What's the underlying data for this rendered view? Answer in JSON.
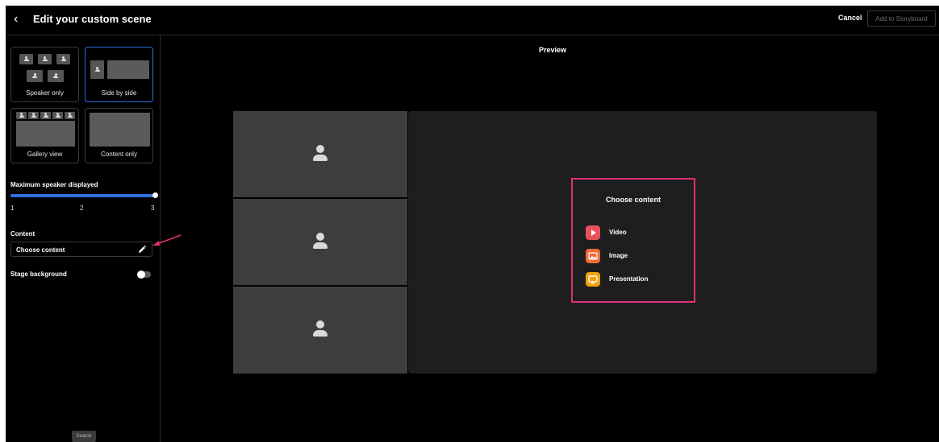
{
  "header": {
    "back_glyph": "‹",
    "title": "Edit your custom scene",
    "cancel_label": "Cancel",
    "add_to_storyboard_label": "Add to Storyboard"
  },
  "sidebar": {
    "layouts": [
      {
        "label": "Speaker only",
        "selected": false,
        "icon": "speaker-only-layout-icon"
      },
      {
        "label": "Side by side",
        "selected": true,
        "icon": "side-by-side-layout-icon"
      },
      {
        "label": "Gallery view",
        "selected": false,
        "icon": "gallery-view-layout-icon"
      },
      {
        "label": "Content only",
        "selected": false,
        "icon": "content-only-layout-icon"
      }
    ],
    "max_speakers": {
      "label": "Maximum speaker displayed",
      "ticks": [
        "1",
        "2",
        "3"
      ],
      "value": 3,
      "min": 1,
      "max": 3
    },
    "content": {
      "label": "Content",
      "field_value": "Choose content",
      "edit_icon": "pencil-icon"
    },
    "stage_background": {
      "label": "Stage background",
      "enabled": false
    },
    "search_label": "Search"
  },
  "preview": {
    "label": "Preview",
    "speaker_tiles": 3,
    "choose_content": {
      "title": "Choose content",
      "options": [
        {
          "label": "Video",
          "icon": "video-play-icon",
          "color": "#e8505b"
        },
        {
          "label": "Image",
          "icon": "image-icon",
          "color": "#ef6a3b"
        },
        {
          "label": "Presentation",
          "icon": "presentation-icon",
          "color": "#f5a00f"
        }
      ]
    }
  },
  "colors": {
    "accent": "#2f6fe0",
    "highlight": "#e0307a",
    "background": "#000000"
  }
}
